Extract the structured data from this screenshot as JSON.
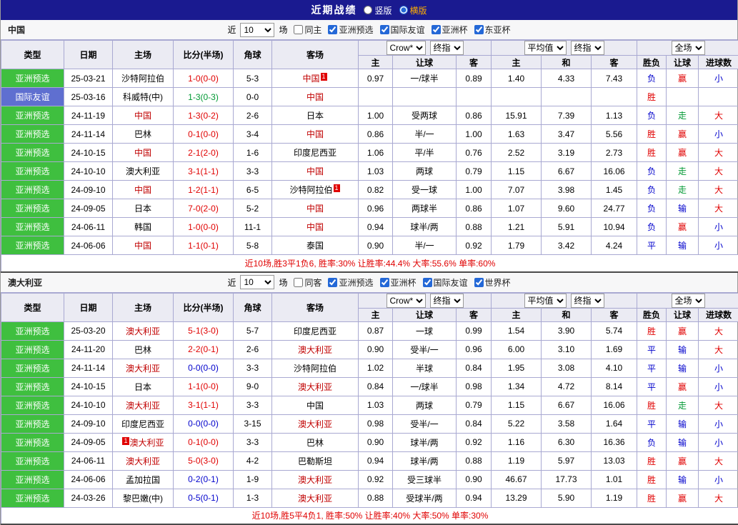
{
  "topbar": {
    "title": "近期战绩",
    "layout_options": [
      {
        "label": "竖版",
        "selected": false
      },
      {
        "label": "横版",
        "selected": true
      }
    ]
  },
  "table_meta": {
    "col_headers": [
      "类型",
      "日期",
      "主场",
      "比分(半场)",
      "角球",
      "客场"
    ],
    "sub_headers": [
      "主",
      "让球",
      "客",
      "主",
      "和",
      "客",
      "胜负",
      "让球",
      "进球数"
    ],
    "odds_group_selects": [
      "Crow*",
      "终指"
    ],
    "avg_group_selects": [
      "平均值",
      "终指"
    ],
    "result_group_selects": [
      "全场"
    ]
  },
  "sections": [
    {
      "team": "中国",
      "filter": {
        "prefix": "近",
        "games": "10",
        "suffix": "场",
        "checkboxes": [
          {
            "label": "同主",
            "checked": false
          },
          {
            "label": "亚洲预选",
            "checked": true
          },
          {
            "label": "国际友谊",
            "checked": true
          },
          {
            "label": "亚洲杯",
            "checked": true
          },
          {
            "label": "东亚杯",
            "checked": true
          }
        ]
      },
      "rows": [
        {
          "type": "亚洲预选",
          "type_style": "green",
          "date": "25-03-21",
          "home": "沙特阿拉伯",
          "home_focus": false,
          "home_badge": "",
          "home_badge_before": false,
          "score": "1-0(0-0)",
          "score_color": "red",
          "corner": "5-3",
          "away": "中国",
          "away_focus": true,
          "away_badge": "1",
          "odds": [
            "0.97",
            "一/球半",
            "0.89",
            "1.40",
            "4.33",
            "7.43"
          ],
          "result": "负",
          "result_color": "blue",
          "let": "赢",
          "let_color": "red",
          "goal": "小",
          "goal_color": "blue"
        },
        {
          "type": "国际友谊",
          "type_style": "blue",
          "date": "25-03-16",
          "home": "科威特(中)",
          "home_focus": false,
          "home_badge": "",
          "home_badge_before": false,
          "score": "1-3(0-3)",
          "score_color": "green",
          "corner": "0-0",
          "away": "中国",
          "away_focus": true,
          "away_badge": "",
          "odds": [
            "",
            "",
            "",
            "",
            "",
            ""
          ],
          "result": "胜",
          "result_color": "red",
          "let": "",
          "let_color": "blue",
          "goal": "",
          "goal_color": "blue"
        },
        {
          "type": "亚洲预选",
          "type_style": "green",
          "date": "24-11-19",
          "home": "中国",
          "home_focus": true,
          "home_badge": "",
          "home_badge_before": false,
          "score": "1-3(0-2)",
          "score_color": "red",
          "corner": "2-6",
          "away": "日本",
          "away_focus": false,
          "away_badge": "",
          "odds": [
            "1.00",
            "受两球",
            "0.86",
            "15.91",
            "7.39",
            "1.13"
          ],
          "result": "负",
          "result_color": "blue",
          "let": "走",
          "let_color": "green",
          "goal": "大",
          "goal_color": "red"
        },
        {
          "type": "亚洲预选",
          "type_style": "green",
          "date": "24-11-14",
          "home": "巴林",
          "home_focus": false,
          "home_badge": "",
          "home_badge_before": false,
          "score": "0-1(0-0)",
          "score_color": "red",
          "corner": "3-4",
          "away": "中国",
          "away_focus": true,
          "away_badge": "",
          "odds": [
            "0.86",
            "半/一",
            "1.00",
            "1.63",
            "3.47",
            "5.56"
          ],
          "result": "胜",
          "result_color": "red",
          "let": "赢",
          "let_color": "red",
          "goal": "小",
          "goal_color": "blue"
        },
        {
          "type": "亚洲预选",
          "type_style": "green",
          "date": "24-10-15",
          "home": "中国",
          "home_focus": true,
          "home_badge": "",
          "home_badge_before": false,
          "score": "2-1(2-0)",
          "score_color": "red",
          "corner": "1-6",
          "away": "印度尼西亚",
          "away_focus": false,
          "away_badge": "",
          "odds": [
            "1.06",
            "平/半",
            "0.76",
            "2.52",
            "3.19",
            "2.73"
          ],
          "result": "胜",
          "result_color": "red",
          "let": "赢",
          "let_color": "red",
          "goal": "大",
          "goal_color": "red"
        },
        {
          "type": "亚洲预选",
          "type_style": "green",
          "date": "24-10-10",
          "home": "澳大利亚",
          "home_focus": false,
          "home_badge": "",
          "home_badge_before": false,
          "score": "3-1(1-1)",
          "score_color": "red",
          "corner": "3-3",
          "away": "中国",
          "away_focus": true,
          "away_badge": "",
          "odds": [
            "1.03",
            "两球",
            "0.79",
            "1.15",
            "6.67",
            "16.06"
          ],
          "result": "负",
          "result_color": "blue",
          "let": "走",
          "let_color": "green",
          "goal": "大",
          "goal_color": "red"
        },
        {
          "type": "亚洲预选",
          "type_style": "green",
          "date": "24-09-10",
          "home": "中国",
          "home_focus": true,
          "home_badge": "",
          "home_badge_before": false,
          "score": "1-2(1-1)",
          "score_color": "red",
          "corner": "6-5",
          "away": "沙特阿拉伯",
          "away_focus": false,
          "away_badge": "1",
          "odds": [
            "0.82",
            "受一球",
            "1.00",
            "7.07",
            "3.98",
            "1.45"
          ],
          "result": "负",
          "result_color": "blue",
          "let": "走",
          "let_color": "green",
          "goal": "大",
          "goal_color": "red"
        },
        {
          "type": "亚洲预选",
          "type_style": "green",
          "date": "24-09-05",
          "home": "日本",
          "home_focus": false,
          "home_badge": "",
          "home_badge_before": false,
          "score": "7-0(2-0)",
          "score_color": "red",
          "corner": "5-2",
          "away": "中国",
          "away_focus": true,
          "away_badge": "",
          "odds": [
            "0.96",
            "两球半",
            "0.86",
            "1.07",
            "9.60",
            "24.77"
          ],
          "result": "负",
          "result_color": "blue",
          "let": "输",
          "let_color": "blue",
          "goal": "大",
          "goal_color": "red"
        },
        {
          "type": "亚洲预选",
          "type_style": "green",
          "date": "24-06-11",
          "home": "韩国",
          "home_focus": false,
          "home_badge": "",
          "home_badge_before": false,
          "score": "1-0(0-0)",
          "score_color": "red",
          "corner": "11-1",
          "away": "中国",
          "away_focus": true,
          "away_badge": "",
          "odds": [
            "0.94",
            "球半/两",
            "0.88",
            "1.21",
            "5.91",
            "10.94"
          ],
          "result": "负",
          "result_color": "blue",
          "let": "赢",
          "let_color": "red",
          "goal": "小",
          "goal_color": "blue"
        },
        {
          "type": "亚洲预选",
          "type_style": "green",
          "date": "24-06-06",
          "home": "中国",
          "home_focus": true,
          "home_badge": "",
          "home_badge_before": false,
          "score": "1-1(0-1)",
          "score_color": "red",
          "corner": "5-8",
          "away": "泰国",
          "away_focus": false,
          "away_badge": "",
          "odds": [
            "0.90",
            "半/一",
            "0.92",
            "1.79",
            "3.42",
            "4.24"
          ],
          "result": "平",
          "result_color": "blue",
          "let": "输",
          "let_color": "blue",
          "goal": "小",
          "goal_color": "blue"
        }
      ],
      "summary": "近10场,胜3平1负6, 胜率:30% 让胜率:44.4% 大率:55.6% 单率:60%"
    },
    {
      "team": "澳大利亚",
      "filter": {
        "prefix": "近",
        "games": "10",
        "suffix": "场",
        "checkboxes": [
          {
            "label": "同客",
            "checked": false
          },
          {
            "label": "亚洲预选",
            "checked": true
          },
          {
            "label": "亚洲杯",
            "checked": true
          },
          {
            "label": "国际友谊",
            "checked": true
          },
          {
            "label": "世界杯",
            "checked": true
          }
        ]
      },
      "rows": [
        {
          "type": "亚洲预选",
          "type_style": "green",
          "date": "25-03-20",
          "home": "澳大利亚",
          "home_focus": true,
          "home_badge": "",
          "home_badge_before": false,
          "score": "5-1(3-0)",
          "score_color": "red",
          "corner": "5-7",
          "away": "印度尼西亚",
          "away_focus": false,
          "away_badge": "",
          "odds": [
            "0.87",
            "一球",
            "0.99",
            "1.54",
            "3.90",
            "5.74"
          ],
          "result": "胜",
          "result_color": "red",
          "let": "赢",
          "let_color": "red",
          "goal": "大",
          "goal_color": "red"
        },
        {
          "type": "亚洲预选",
          "type_style": "green",
          "date": "24-11-20",
          "home": "巴林",
          "home_focus": false,
          "home_badge": "",
          "home_badge_before": false,
          "score": "2-2(0-1)",
          "score_color": "red",
          "corner": "2-6",
          "away": "澳大利亚",
          "away_focus": true,
          "away_badge": "",
          "odds": [
            "0.90",
            "受半/一",
            "0.96",
            "6.00",
            "3.10",
            "1.69"
          ],
          "result": "平",
          "result_color": "blue",
          "let": "输",
          "let_color": "blue",
          "goal": "大",
          "goal_color": "red"
        },
        {
          "type": "亚洲预选",
          "type_style": "green",
          "date": "24-11-14",
          "home": "澳大利亚",
          "home_focus": true,
          "home_badge": "",
          "home_badge_before": false,
          "score": "0-0(0-0)",
          "score_color": "blue",
          "corner": "3-3",
          "away": "沙特阿拉伯",
          "away_focus": false,
          "away_badge": "",
          "odds": [
            "1.02",
            "半球",
            "0.84",
            "1.95",
            "3.08",
            "4.10"
          ],
          "result": "平",
          "result_color": "blue",
          "let": "输",
          "let_color": "blue",
          "goal": "小",
          "goal_color": "blue"
        },
        {
          "type": "亚洲预选",
          "type_style": "green",
          "date": "24-10-15",
          "home": "日本",
          "home_focus": false,
          "home_badge": "",
          "home_badge_before": false,
          "score": "1-1(0-0)",
          "score_color": "red",
          "corner": "9-0",
          "away": "澳大利亚",
          "away_focus": true,
          "away_badge": "",
          "odds": [
            "0.84",
            "一/球半",
            "0.98",
            "1.34",
            "4.72",
            "8.14"
          ],
          "result": "平",
          "result_color": "blue",
          "let": "赢",
          "let_color": "red",
          "goal": "小",
          "goal_color": "blue"
        },
        {
          "type": "亚洲预选",
          "type_style": "green",
          "date": "24-10-10",
          "home": "澳大利亚",
          "home_focus": true,
          "home_badge": "",
          "home_badge_before": false,
          "score": "3-1(1-1)",
          "score_color": "red",
          "corner": "3-3",
          "away": "中国",
          "away_focus": false,
          "away_badge": "",
          "odds": [
            "1.03",
            "两球",
            "0.79",
            "1.15",
            "6.67",
            "16.06"
          ],
          "result": "胜",
          "result_color": "red",
          "let": "走",
          "let_color": "green",
          "goal": "大",
          "goal_color": "red"
        },
        {
          "type": "亚洲预选",
          "type_style": "green",
          "date": "24-09-10",
          "home": "印度尼西亚",
          "home_focus": false,
          "home_badge": "",
          "home_badge_before": false,
          "score": "0-0(0-0)",
          "score_color": "blue",
          "corner": "3-15",
          "away": "澳大利亚",
          "away_focus": true,
          "away_badge": "",
          "odds": [
            "0.98",
            "受半/一",
            "0.84",
            "5.22",
            "3.58",
            "1.64"
          ],
          "result": "平",
          "result_color": "blue",
          "let": "输",
          "let_color": "blue",
          "goal": "小",
          "goal_color": "blue"
        },
        {
          "type": "亚洲预选",
          "type_style": "green",
          "date": "24-09-05",
          "home": "澳大利亚",
          "home_focus": true,
          "home_badge": "1",
          "home_badge_before": true,
          "score": "0-1(0-0)",
          "score_color": "red",
          "corner": "3-3",
          "away": "巴林",
          "away_focus": false,
          "away_badge": "",
          "odds": [
            "0.90",
            "球半/两",
            "0.92",
            "1.16",
            "6.30",
            "16.36"
          ],
          "result": "负",
          "result_color": "blue",
          "let": "输",
          "let_color": "blue",
          "goal": "小",
          "goal_color": "blue"
        },
        {
          "type": "亚洲预选",
          "type_style": "green",
          "date": "24-06-11",
          "home": "澳大利亚",
          "home_focus": true,
          "home_badge": "",
          "home_badge_before": false,
          "score": "5-0(3-0)",
          "score_color": "red",
          "corner": "4-2",
          "away": "巴勒斯坦",
          "away_focus": false,
          "away_badge": "",
          "odds": [
            "0.94",
            "球半/两",
            "0.88",
            "1.19",
            "5.97",
            "13.03"
          ],
          "result": "胜",
          "result_color": "red",
          "let": "赢",
          "let_color": "red",
          "goal": "大",
          "goal_color": "red"
        },
        {
          "type": "亚洲预选",
          "type_style": "green",
          "date": "24-06-06",
          "home": "孟加拉国",
          "home_focus": false,
          "home_badge": "",
          "home_badge_before": false,
          "score": "0-2(0-1)",
          "score_color": "blue",
          "corner": "1-9",
          "away": "澳大利亚",
          "away_focus": true,
          "away_badge": "",
          "odds": [
            "0.92",
            "受三球半",
            "0.90",
            "46.67",
            "17.73",
            "1.01"
          ],
          "result": "胜",
          "result_color": "red",
          "let": "输",
          "let_color": "blue",
          "goal": "小",
          "goal_color": "blue"
        },
        {
          "type": "亚洲预选",
          "type_style": "green",
          "date": "24-03-26",
          "home": "黎巴嫩(中)",
          "home_focus": false,
          "home_badge": "",
          "home_badge_before": false,
          "score": "0-5(0-1)",
          "score_color": "blue",
          "corner": "1-3",
          "away": "澳大利亚",
          "away_focus": true,
          "away_badge": "",
          "odds": [
            "0.88",
            "受球半/两",
            "0.94",
            "13.29",
            "5.90",
            "1.19"
          ],
          "result": "胜",
          "result_color": "red",
          "let": "赢",
          "let_color": "red",
          "goal": "大",
          "goal_color": "red"
        }
      ],
      "summary": "近10场,胜5平4负1, 胜率:50% 让胜率:40% 大率:50% 单率:30%"
    }
  ]
}
